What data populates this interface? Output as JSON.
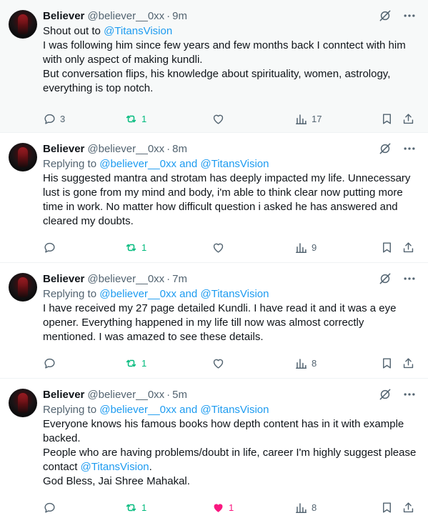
{
  "tweets": [
    {
      "name": "Believer",
      "handle": "@believer__0xx",
      "sep": "·",
      "time": "9m",
      "reply_prefix": "",
      "reply_user1": "",
      "reply_and": "",
      "reply_user2": "",
      "lines": [
        {
          "pre": "Shout out to ",
          "link": "@TitansVision",
          "post": ""
        },
        {
          "pre": "I was following him since few years and few months back I conntect with him with only aspect of making kundli.",
          "link": "",
          "post": ""
        },
        {
          "pre": "But conversation flips, his knowledge about spirituality, women, astrology, everything is top notch.",
          "link": "",
          "post": ""
        }
      ],
      "replies": "3",
      "reposts": "1",
      "likes": "",
      "views": "17",
      "liked": false
    },
    {
      "name": "Believer",
      "handle": "@believer__0xx",
      "sep": "·",
      "time": "8m",
      "reply_prefix": "Replying to ",
      "reply_user1": "@believer__0xx",
      "reply_and": " and ",
      "reply_user2": "@TitansVision",
      "lines": [
        {
          "pre": "His suggested mantra and strotam has deeply impacted my life. Unnecessary lust is gone from my mind and body, i'm able to think clear now putting more time in work. No matter how difficult question i asked he has answered and cleared my doubts.",
          "link": "",
          "post": ""
        }
      ],
      "replies": "",
      "reposts": "1",
      "likes": "",
      "views": "9",
      "liked": false
    },
    {
      "name": "Believer",
      "handle": "@believer__0xx",
      "sep": "·",
      "time": "7m",
      "reply_prefix": "Replying to ",
      "reply_user1": "@believer__0xx",
      "reply_and": " and ",
      "reply_user2": "@TitansVision",
      "lines": [
        {
          "pre": "I have received my 27 page detailed Kundli. I have read it and it was a eye opener. Everything happened in my life till now was almost correctly mentioned. I was amazed to see these details.",
          "link": "",
          "post": ""
        }
      ],
      "replies": "",
      "reposts": "1",
      "likes": "",
      "views": "8",
      "liked": false
    },
    {
      "name": "Believer",
      "handle": "@believer__0xx",
      "sep": "·",
      "time": "5m",
      "reply_prefix": "Replying to ",
      "reply_user1": "@believer__0xx",
      "reply_and": " and ",
      "reply_user2": "@TitansVision",
      "lines": [
        {
          "pre": "Everyone knows his famous books how depth content has in it with example backed.",
          "link": "",
          "post": ""
        },
        {
          "pre": "People who are having problems/doubt in life, career I'm highly suggest please contact ",
          "link": "@TitansVision",
          "post": "."
        },
        {
          "pre": "God Bless, Jai Shree Mahakal.",
          "link": "",
          "post": ""
        }
      ],
      "replies": "",
      "reposts": "1",
      "likes": "1",
      "views": "8",
      "liked": true
    }
  ],
  "colors": {
    "link": "#1d9bf0",
    "repost_active": "#00ba7c",
    "like_active": "#f91880",
    "muted": "#536471"
  },
  "icons": [
    "grok-icon",
    "more-icon",
    "reply-icon",
    "repost-icon",
    "like-icon",
    "views-icon",
    "bookmark-icon",
    "share-icon"
  ]
}
